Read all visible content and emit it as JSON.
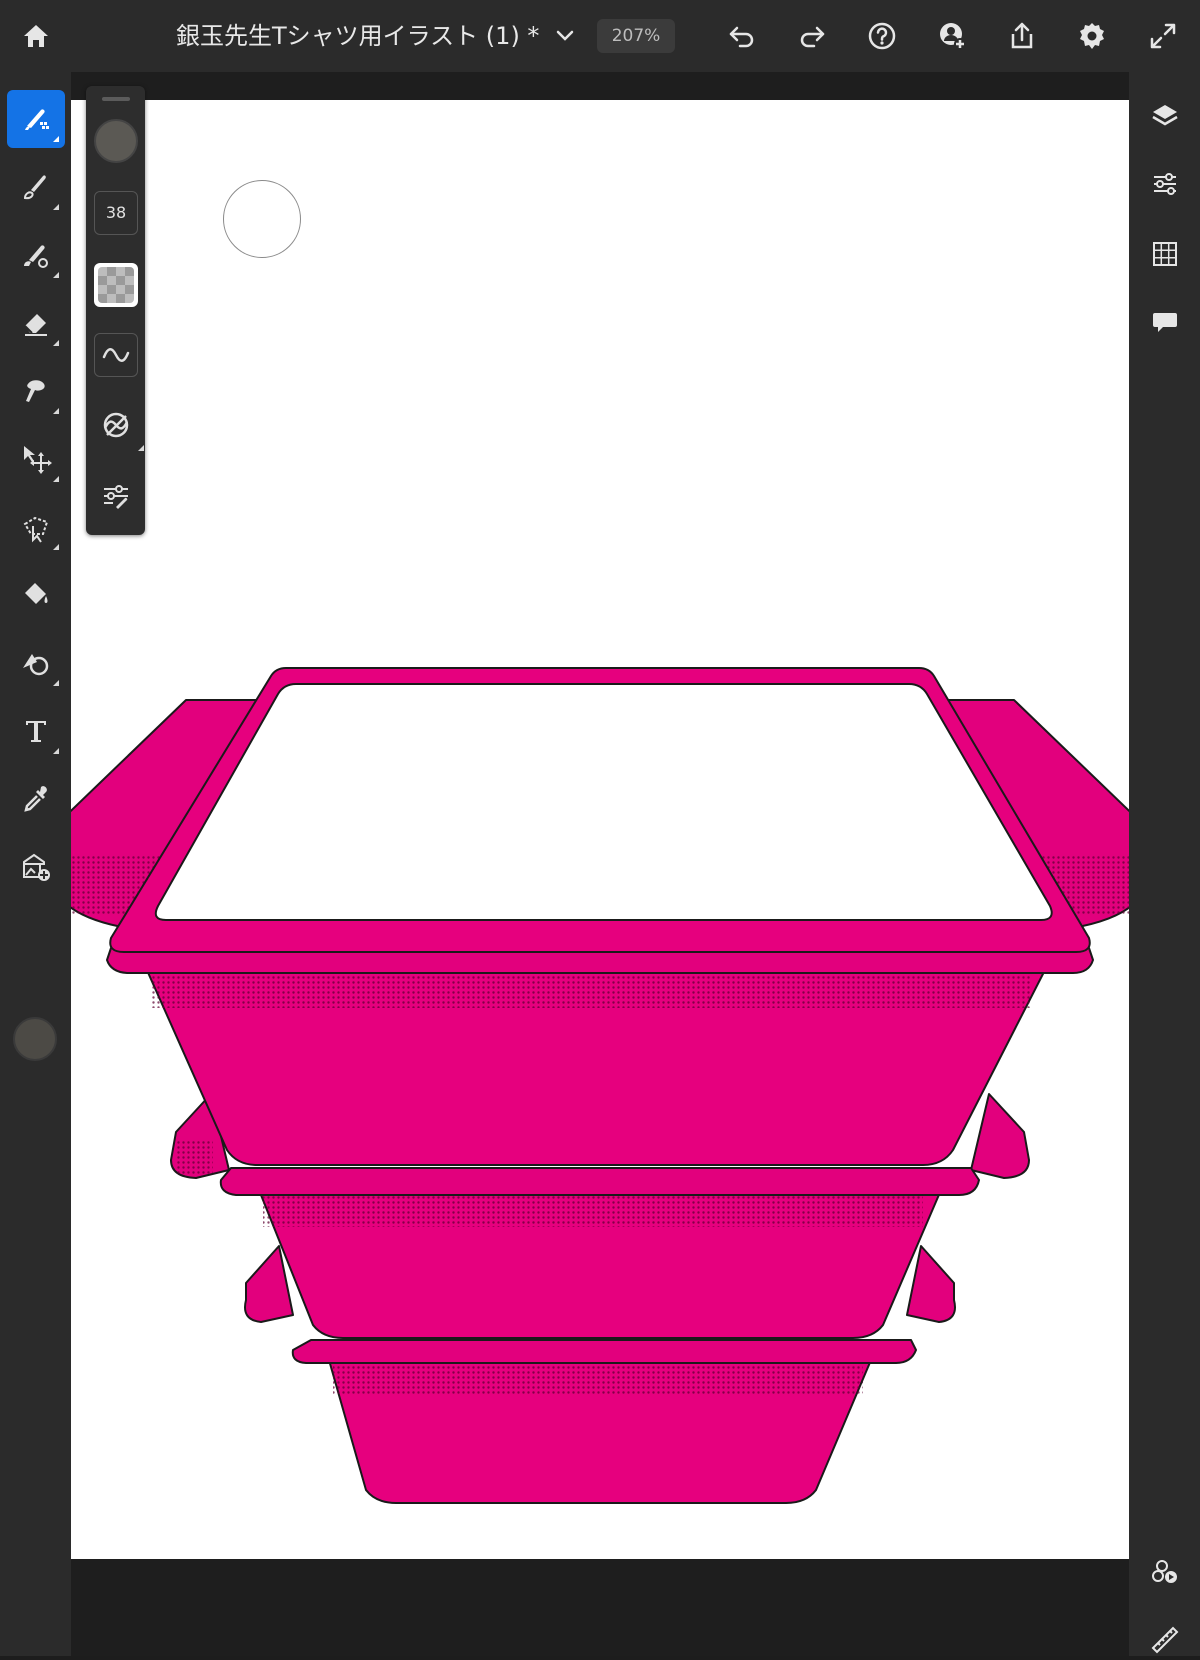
{
  "app": {
    "document_title": "銀玉先生Tシャツ用イラスト (1) *",
    "zoom": "207%"
  },
  "top_bar": {
    "icons": [
      "home-icon",
      "chevron-down-icon",
      "undo-icon",
      "redo-icon",
      "help-icon",
      "invite-icon",
      "share-icon",
      "settings-icon",
      "fullscreen-icon"
    ]
  },
  "left_toolbar": {
    "tools": [
      "brush",
      "smudge",
      "fill-brush",
      "eraser",
      "liquify",
      "move",
      "lasso",
      "paint-bucket",
      "shape",
      "text",
      "eyedropper",
      "place-image"
    ],
    "active_tool": "brush",
    "color": "#4c4a45"
  },
  "brush_panel": {
    "size": "38",
    "color": "#5b5954",
    "controls": [
      "brush-color",
      "brush-size",
      "opacity",
      "smoothing",
      "pressure",
      "brush-settings"
    ]
  },
  "right_panel": {
    "icons": [
      "layers-icon",
      "adjustments-icon",
      "grid-icon",
      "comments-icon",
      "mask-icon",
      "ruler-icon"
    ]
  },
  "artwork": {
    "fill_color": "#e6007e",
    "outline_color": "#1a1a1a",
    "description_shape": "stacked magenta trays"
  },
  "colors": {
    "accent": "#1473e6",
    "toolbar_bg": "#2b2b2b",
    "canvas_bg": "#ffffff"
  }
}
